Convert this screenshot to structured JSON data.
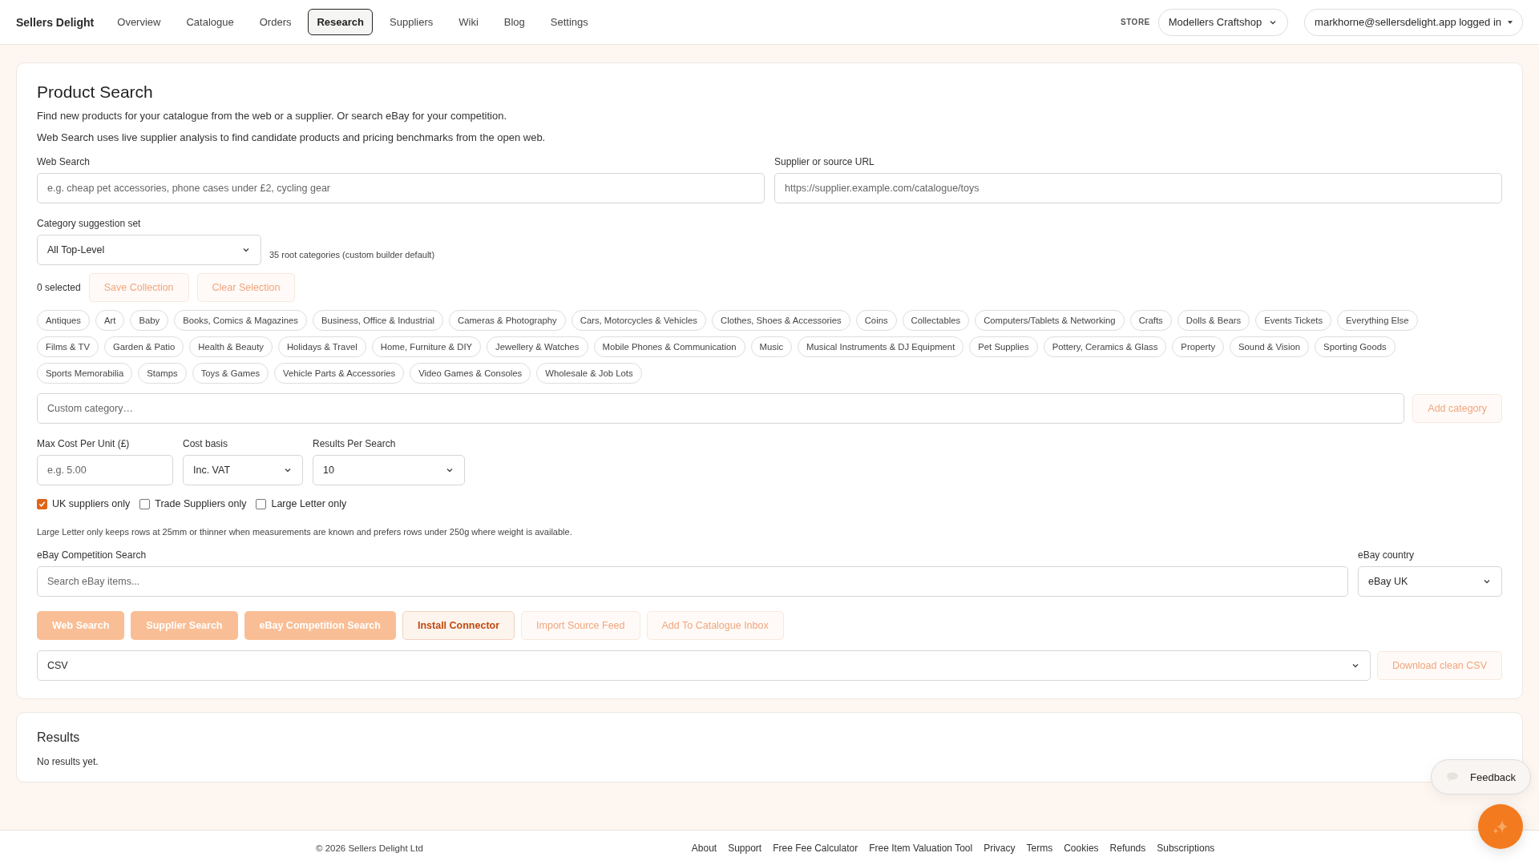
{
  "nav": {
    "brand": "Sellers Delight",
    "items": [
      {
        "label": "Overview",
        "selected": false
      },
      {
        "label": "Catalogue",
        "selected": false
      },
      {
        "label": "Orders",
        "selected": false
      },
      {
        "label": "Research",
        "selected": true
      },
      {
        "label": "Suppliers",
        "selected": false
      },
      {
        "label": "Wiki",
        "selected": false
      },
      {
        "label": "Blog",
        "selected": false
      },
      {
        "label": "Settings",
        "selected": false
      }
    ],
    "store_label": "STORE",
    "store": "Modellers Craftshop",
    "account": "markhorne@sellersdelight.app logged in"
  },
  "search": {
    "title": "Product Search",
    "description": [
      "Find new products for your catalogue from the web or a supplier. Or search eBay for your competition.",
      "Web Search uses live supplier analysis to find candidate products and pricing benchmarks from the open web."
    ],
    "web_search": {
      "label": "Web Search",
      "placeholder": "e.g. cheap pet accessories, phone cases under £2, cycling gear"
    },
    "supplier_url": {
      "label": "Supplier or source URL",
      "placeholder": "https://supplier.example.com/catalogue/toys"
    },
    "category_set": {
      "label": "Category suggestion set",
      "value": "All Top-Level",
      "note": "35 root categories (custom builder default)"
    },
    "selection": {
      "count": "0 selected",
      "buttons": [
        {
          "label": "Save Collection",
          "kind": "faint"
        },
        {
          "label": "Clear Selection",
          "kind": "faint"
        }
      ]
    },
    "categories": [
      {
        "label": "Antiques",
        "selected": false
      },
      {
        "label": "Art",
        "selected": false
      },
      {
        "label": "Baby",
        "selected": false
      },
      {
        "label": "Books, Comics & Magazines",
        "selected": false
      },
      {
        "label": "Business, Office & Industrial",
        "selected": false
      },
      {
        "label": "Cameras & Photography",
        "selected": false
      },
      {
        "label": "Cars, Motorcycles & Vehicles",
        "selected": false
      },
      {
        "label": "Clothes, Shoes & Accessories",
        "selected": false
      },
      {
        "label": "Coins",
        "selected": false
      },
      {
        "label": "Collectables",
        "selected": false
      },
      {
        "label": "Computers/Tablets & Networking",
        "selected": false
      },
      {
        "label": "Crafts",
        "selected": false
      },
      {
        "label": "Dolls & Bears",
        "selected": false
      },
      {
        "label": "Events Tickets",
        "selected": false
      },
      {
        "label": "Everything Else",
        "selected": false
      },
      {
        "label": "Films & TV",
        "selected": false
      },
      {
        "label": "Garden & Patio",
        "selected": false
      },
      {
        "label": "Health & Beauty",
        "selected": false
      },
      {
        "label": "Holidays & Travel",
        "selected": false
      },
      {
        "label": "Home, Furniture & DIY",
        "selected": false
      },
      {
        "label": "Jewellery & Watches",
        "selected": false
      },
      {
        "label": "Mobile Phones & Communication",
        "selected": false
      },
      {
        "label": "Music",
        "selected": false
      },
      {
        "label": "Musical Instruments & DJ Equipment",
        "selected": false
      },
      {
        "label": "Pet Supplies",
        "selected": false
      },
      {
        "label": "Pottery, Ceramics & Glass",
        "selected": false
      },
      {
        "label": "Property",
        "selected": false
      },
      {
        "label": "Sound & Vision",
        "selected": false
      },
      {
        "label": "Sporting Goods",
        "selected": false
      },
      {
        "label": "Sports Memorabilia",
        "selected": false
      },
      {
        "label": "Stamps",
        "selected": false
      },
      {
        "label": "Toys & Games",
        "selected": false
      },
      {
        "label": "Vehicle Parts & Accessories",
        "selected": false
      },
      {
        "label": "Video Games & Consoles",
        "selected": false
      },
      {
        "label": "Wholesale & Job Lots",
        "selected": false
      }
    ],
    "custom_category": {
      "placeholder": "Custom category…",
      "button": {
        "label": "Add category",
        "kind": "faint"
      }
    },
    "max_cost": {
      "label": "Max Cost Per Unit (£)",
      "placeholder": "e.g. 5.00"
    },
    "cost_basis": {
      "label": "Cost basis",
      "value": "Inc. VAT"
    },
    "results_per_search": {
      "label": "Results Per Search",
      "value": "10"
    },
    "options": [
      {
        "label": "UK suppliers only",
        "checked": true
      },
      {
        "label": "Trade Suppliers only",
        "checked": false
      },
      {
        "label": "Large Letter only",
        "checked": false
      }
    ],
    "options_note": "Large Letter only keeps rows at 25mm or thinner when measurements are known and prefers rows under 250g where weight is available.",
    "ebay_search": {
      "label": "eBay Competition Search",
      "placeholder": "Search eBay items..."
    },
    "ebay_country": {
      "label": "eBay country",
      "value": "eBay UK"
    },
    "actions": [
      {
        "label": "Web Search",
        "kind": "primary"
      },
      {
        "label": "Supplier Search",
        "kind": "primary"
      },
      {
        "label": "eBay Competition Search",
        "kind": "primary"
      },
      {
        "label": "Install Connector",
        "kind": "outline"
      },
      {
        "label": "Import Source Feed",
        "kind": "faint"
      },
      {
        "label": "Add To Catalogue Inbox",
        "kind": "faint"
      }
    ],
    "export_format": {
      "value": "CSV",
      "button": {
        "label": "Download clean CSV",
        "kind": "faint"
      }
    }
  },
  "results": {
    "title": "Results",
    "message": "No results yet."
  },
  "footer": {
    "copyright": "© 2026 Sellers Delight Ltd",
    "links": [
      "About",
      "Support",
      "Free Fee Calculator",
      "Free Item Valuation Tool",
      "Privacy",
      "Terms",
      "Cookies",
      "Refunds",
      "Subscriptions"
    ]
  },
  "feedback": "Feedback"
}
